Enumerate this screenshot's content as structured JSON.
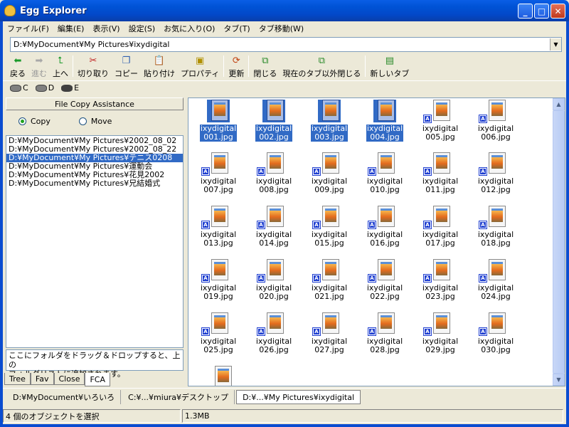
{
  "window": {
    "title": "Egg Explorer",
    "min": "_",
    "max": "□",
    "close": "✕"
  },
  "menu": [
    "ファイル(F)",
    "編集(E)",
    "表示(V)",
    "設定(S)",
    "お気に入り(O)",
    "タブ(T)",
    "タブ移動(W)"
  ],
  "address": {
    "value": "D:¥MyDocument¥My Pictures¥ixydigital"
  },
  "toolbar": {
    "back": "戻る",
    "forward": "進む",
    "up": "上へ",
    "cut": "切り取り",
    "copy": "コピー",
    "paste": "貼り付け",
    "properties": "プロパティ",
    "refresh": "更新",
    "close": "閉じる",
    "close_others": "現在のタブ以外閉じる",
    "new_tab": "新しいタブ"
  },
  "drives": [
    "C",
    "D",
    "E"
  ],
  "fca": {
    "title": "File Copy Assistance",
    "copy_label": "Copy",
    "move_label": "Move",
    "selected_mode": "Copy",
    "folders": [
      "D:¥MyDocument¥My Pictures¥2002_08_02",
      "D:¥MyDocument¥My Pictures¥2002_08_22",
      "D:¥MyDocument¥My Pictures¥テニス0208",
      "D:¥MyDocument¥My Pictures¥運動会",
      "D:¥MyDocument¥My Pictures¥花見2002",
      "D:¥MyDocument¥My Pictures¥兄結婚式"
    ],
    "selected_folder_index": 2,
    "hint_line1": "ここにフォルダをドラッグ＆ドロップすると、上の",
    "hint_line2": "フォルダリストに追加されます。"
  },
  "left_tabs": [
    "Tree",
    "Fav",
    "Close",
    "FCA"
  ],
  "left_active_tab": "FCA",
  "files": [
    {
      "name1": "ixydigital",
      "name2": "001.jpg",
      "selected": true
    },
    {
      "name1": "ixydigital",
      "name2": "002.jpg",
      "selected": true
    },
    {
      "name1": "ixydigital",
      "name2": "003.jpg",
      "selected": true
    },
    {
      "name1": "ixydigital",
      "name2": "004.jpg",
      "selected": true
    },
    {
      "name1": "ixydigital",
      "name2": "005.jpg",
      "selected": false
    },
    {
      "name1": "ixydigital",
      "name2": "006.jpg",
      "selected": false
    },
    {
      "name1": "ixydigital",
      "name2": "007.jpg",
      "selected": false
    },
    {
      "name1": "ixydigital",
      "name2": "008.jpg",
      "selected": false
    },
    {
      "name1": "ixydigital",
      "name2": "009.jpg",
      "selected": false
    },
    {
      "name1": "ixydigital",
      "name2": "010.jpg",
      "selected": false
    },
    {
      "name1": "ixydigital",
      "name2": "011.jpg",
      "selected": false
    },
    {
      "name1": "ixydigital",
      "name2": "012.jpg",
      "selected": false
    },
    {
      "name1": "ixydigital",
      "name2": "013.jpg",
      "selected": false
    },
    {
      "name1": "ixydigital",
      "name2": "014.jpg",
      "selected": false
    },
    {
      "name1": "ixydigital",
      "name2": "015.jpg",
      "selected": false
    },
    {
      "name1": "ixydigital",
      "name2": "016.jpg",
      "selected": false
    },
    {
      "name1": "ixydigital",
      "name2": "017.jpg",
      "selected": false
    },
    {
      "name1": "ixydigital",
      "name2": "018.jpg",
      "selected": false
    },
    {
      "name1": "ixydigital",
      "name2": "019.jpg",
      "selected": false
    },
    {
      "name1": "ixydigital",
      "name2": "020.jpg",
      "selected": false
    },
    {
      "name1": "ixydigital",
      "name2": "021.jpg",
      "selected": false
    },
    {
      "name1": "ixydigital",
      "name2": "022.jpg",
      "selected": false
    },
    {
      "name1": "ixydigital",
      "name2": "023.jpg",
      "selected": false
    },
    {
      "name1": "ixydigital",
      "name2": "024.jpg",
      "selected": false
    },
    {
      "name1": "ixydigital",
      "name2": "025.jpg",
      "selected": false
    },
    {
      "name1": "ixydigital",
      "name2": "026.jpg",
      "selected": false
    },
    {
      "name1": "ixydigital",
      "name2": "027.jpg",
      "selected": false
    },
    {
      "name1": "ixydigital",
      "name2": "028.jpg",
      "selected": false
    },
    {
      "name1": "ixydigital",
      "name2": "029.jpg",
      "selected": false
    },
    {
      "name1": "ixydigital",
      "name2": "030.jpg",
      "selected": false
    }
  ],
  "bottom_tabs": [
    "D:¥MyDocument¥いろいろ",
    "C:¥...¥miura¥デスクトップ",
    "D:¥...¥My Pictures¥ixydigital"
  ],
  "bottom_active_tab": 2,
  "status": {
    "selection": "4 個のオブジェクトを選択",
    "size": "1.3MB"
  }
}
